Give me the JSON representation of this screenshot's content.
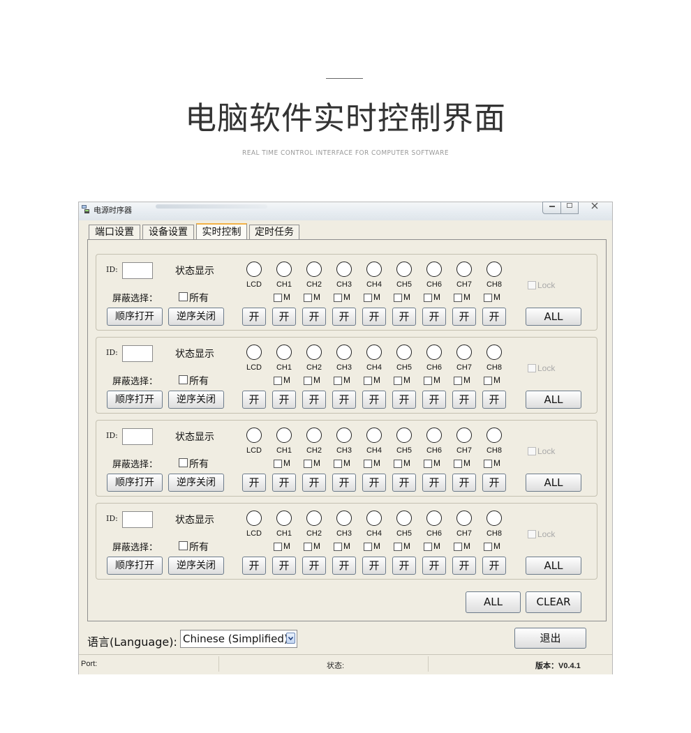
{
  "hero": {
    "title": "电脑软件实时控制界面",
    "subtitle": "REAL TIME CONTROL INTERFACE FOR COMPUTER SOFTWARE"
  },
  "window": {
    "title": "电源时序器",
    "min_icon": "minimize-icon",
    "max_icon": "maximize-icon",
    "close_label": "ᚷ"
  },
  "tabs": [
    {
      "label": "端口设置"
    },
    {
      "label": "设备设置"
    },
    {
      "label": "实时控制"
    },
    {
      "label": "定时任务"
    }
  ],
  "active_tab": 2,
  "group_labels": {
    "id": "ID:",
    "status": "状态显示",
    "mask": "屏蔽选择：",
    "all": "所有",
    "seq_on": "顺序打开",
    "seq_off": "逆序关闭",
    "on": "开",
    "lock": "Lock",
    "all_btn": "ALL",
    "m": "M",
    "channels": [
      "LCD",
      "CH1",
      "CH2",
      "CH3",
      "CH4",
      "CH5",
      "CH6",
      "CH7",
      "CH8"
    ]
  },
  "groups": [
    {},
    {},
    {},
    {}
  ],
  "bottom": {
    "all_label": "ALL",
    "clear_label": "CLEAR"
  },
  "language": {
    "label": "语言(Language):",
    "selected": "Chinese (Simplified)",
    "arrow_icon": "chevron-down-icon"
  },
  "exit_label": "退出",
  "statusbar": {
    "port": "Port:",
    "status": "状态:",
    "version": "版本：V0.4.1"
  },
  "colors": {
    "window_bg": "#f0ede2",
    "active_tab_accent": "#f2b146"
  }
}
